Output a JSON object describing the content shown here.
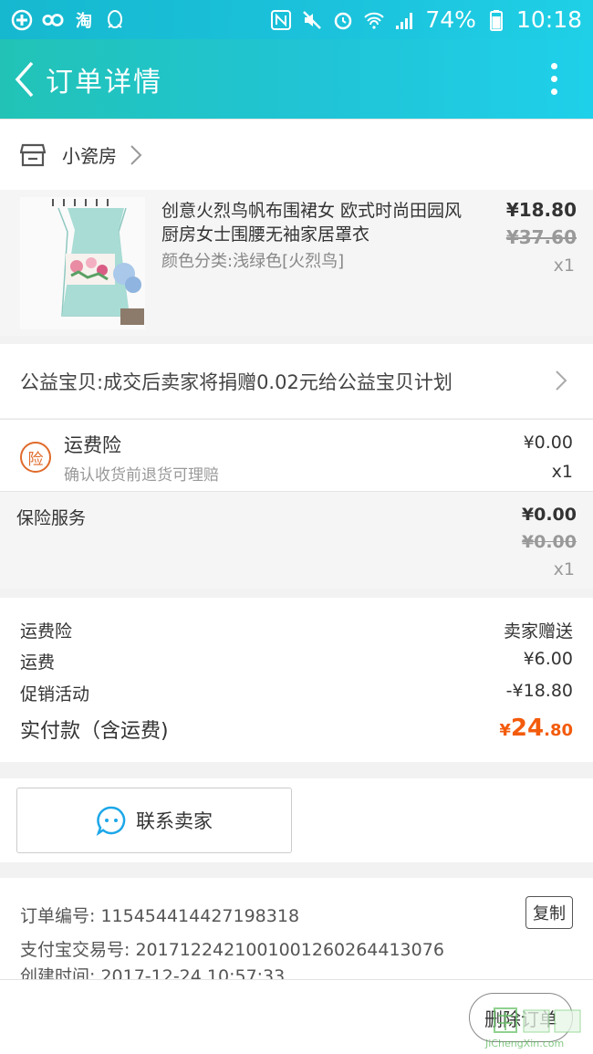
{
  "status_bar": {
    "time": "10:18",
    "battery": "74%"
  },
  "nav": {
    "title": "订单详情"
  },
  "shop": {
    "name": "小瓷房"
  },
  "item": {
    "title": "创意火烈鸟帆布围裙女 欧式时尚田园风厨房女士围腰无袖家居罩衣",
    "spec": "颜色分类:浅绿色[火烈鸟]",
    "price": "¥18.80",
    "original_price": "¥37.60",
    "quantity": "x1"
  },
  "charity": {
    "text": "公益宝贝:成交后卖家将捐赠0.02元给公益宝贝计划"
  },
  "insurance": {
    "badge": "险",
    "title": "运费险",
    "subtitle": "确认收货前退货可理赔",
    "price": "¥0.00",
    "quantity": "x1"
  },
  "service": {
    "title": "保险服务",
    "price": "¥0.00",
    "original_price": "¥0.00",
    "quantity": "x1"
  },
  "summary": {
    "rows": [
      {
        "label": "运费险",
        "value": "卖家赠送"
      },
      {
        "label": "运费",
        "value": "¥6.00"
      },
      {
        "label": "促销活动",
        "value": "-¥18.80"
      }
    ],
    "total_label": "实付款（含运费)",
    "total_currency": "¥",
    "total_int": "24",
    "total_dec": ".80"
  },
  "contact": {
    "label": "联系卖家"
  },
  "order_info": {
    "order_no": "订单编号: 115454414427198318",
    "alipay_no": "支付宝交易号: 2017122421001001260264413076",
    "created": "创建时间: 2017-12-24 10:57:33",
    "copy_label": "复制"
  },
  "bottom": {
    "delete_label": "删除订单"
  },
  "watermark": {
    "text": "JiChengXin.com"
  },
  "colors": {
    "header_start": "#22c3b6",
    "header_end": "#1fd0ea",
    "accent_orange": "#f35b0c",
    "badge_orange": "#e06a2a"
  }
}
